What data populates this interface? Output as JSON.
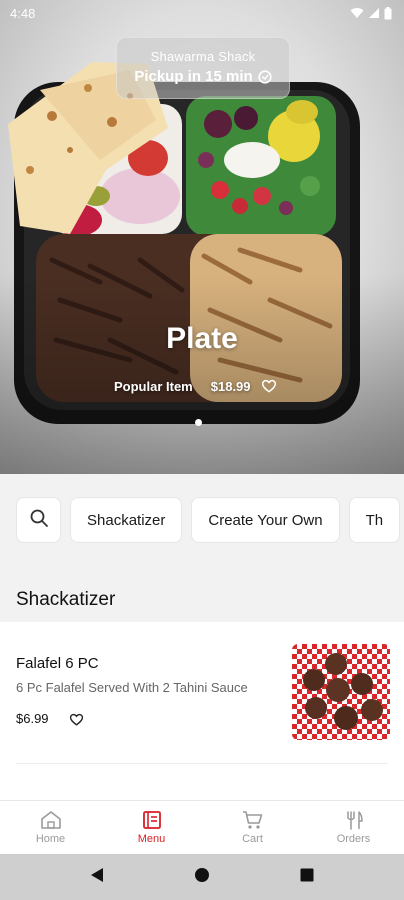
{
  "status_bar": {
    "time": "4:48",
    "icons": [
      "wifi-icon",
      "signal-icon",
      "battery-icon"
    ]
  },
  "hero": {
    "restaurant_name": "Shawarma Shack",
    "pickup_text": "Pickup in 15 min",
    "item_title": "Plate",
    "tag": "Popular Item",
    "price": "$18.99",
    "carousel_dots": 1,
    "active_dot": 0
  },
  "categories": {
    "search_icon": "search-icon",
    "chips": [
      "Shackatizer",
      "Create Your Own",
      "Th"
    ]
  },
  "section": {
    "title": "Shackatizer"
  },
  "items": [
    {
      "name": "Falafel 6 PC",
      "description": "6 Pc Falafel Served With 2 Tahini Sauce",
      "price": "$6.99"
    }
  ],
  "bottom_nav": {
    "items": [
      {
        "label": "Home",
        "icon": "home-icon"
      },
      {
        "label": "Menu",
        "icon": "menu-icon"
      },
      {
        "label": "Cart",
        "icon": "cart-icon"
      },
      {
        "label": "Orders",
        "icon": "fork-knife-icon"
      }
    ],
    "active": "Menu"
  },
  "colors": {
    "accent": "#d81f26",
    "inactive": "#9a9a9a",
    "background": "#f2f2f2"
  }
}
